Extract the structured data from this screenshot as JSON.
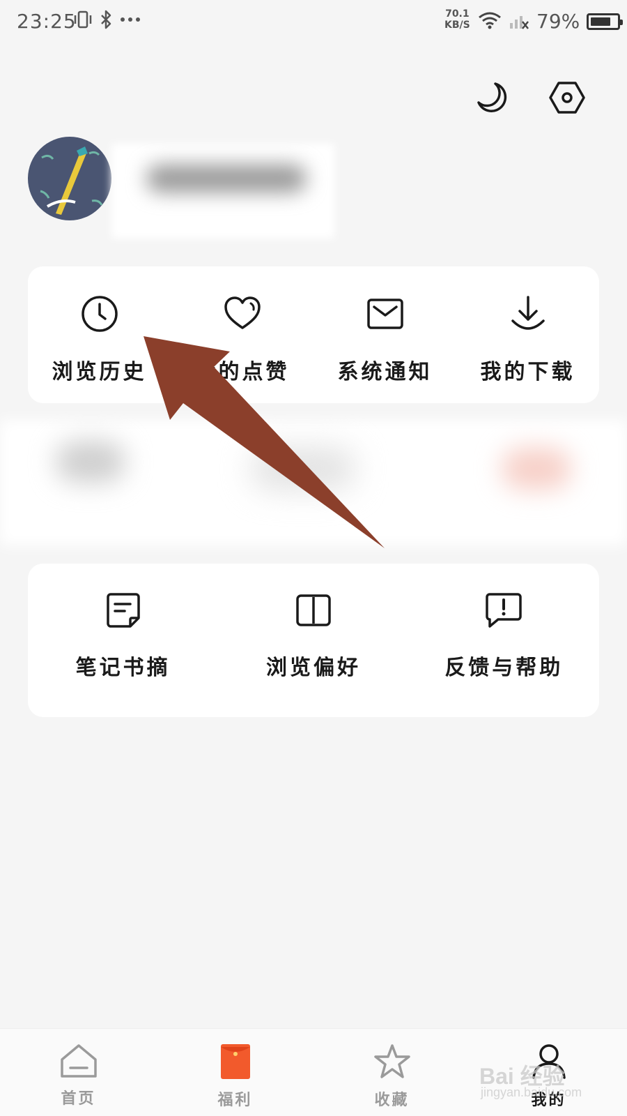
{
  "status_bar": {
    "time": "23:25",
    "net_speed_value": "70.1",
    "net_speed_unit": "KB/S",
    "battery": "79%",
    "battery_level": 0.79,
    "icons": [
      "vibrate-icon",
      "bluetooth-icon",
      "more-dots-icon",
      "wifi-icon",
      "signal-icon",
      "battery-icon"
    ]
  },
  "top_actions": {
    "night_mode_icon": "moon-icon",
    "settings_icon": "hexagon-settings-icon"
  },
  "quick_actions": [
    {
      "label": "浏览历史",
      "icon": "clock-icon"
    },
    {
      "label": "我的点赞",
      "icon": "heart-icon"
    },
    {
      "label": "系统通知",
      "icon": "mail-icon"
    },
    {
      "label": "我的下载",
      "icon": "download-icon"
    }
  ],
  "tools": [
    {
      "label": "笔记书摘",
      "icon": "note-icon"
    },
    {
      "label": "浏览偏好",
      "icon": "book-icon"
    },
    {
      "label": "反馈与帮助",
      "icon": "feedback-icon"
    }
  ],
  "bottom_nav": [
    {
      "label": "首页",
      "icon": "home-icon",
      "active": false
    },
    {
      "label": "福利",
      "icon": "red-envelope-icon",
      "active": false
    },
    {
      "label": "收藏",
      "icon": "star-icon",
      "active": false
    },
    {
      "label": "我的",
      "icon": "user-icon",
      "active": true
    }
  ],
  "watermark": {
    "text": "Bai 经验",
    "sub": "jingyan.baidu.com"
  },
  "colors": {
    "background": "#f5f5f5",
    "card": "#ffffff",
    "arrow": "#8b3f2b",
    "icon": "#1a1a1a",
    "nav_inactive": "#9a9a9a",
    "envelope": "#f25a2c"
  }
}
